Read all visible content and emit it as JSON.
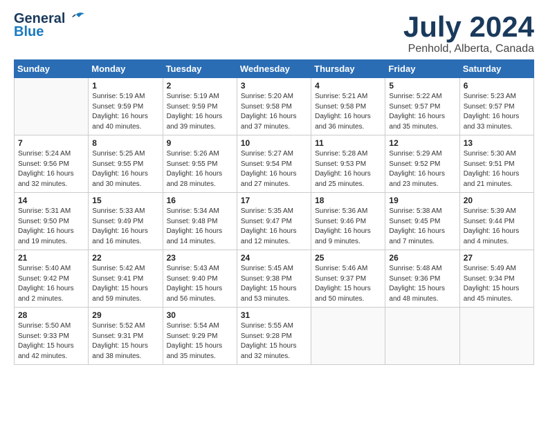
{
  "logo": {
    "line1": "General",
    "line2": "Blue"
  },
  "title": "July 2024",
  "subtitle": "Penhold, Alberta, Canada",
  "days_of_week": [
    "Sunday",
    "Monday",
    "Tuesday",
    "Wednesday",
    "Thursday",
    "Friday",
    "Saturday"
  ],
  "weeks": [
    [
      {
        "day": "",
        "info": ""
      },
      {
        "day": "1",
        "info": "Sunrise: 5:19 AM\nSunset: 9:59 PM\nDaylight: 16 hours\nand 40 minutes."
      },
      {
        "day": "2",
        "info": "Sunrise: 5:19 AM\nSunset: 9:59 PM\nDaylight: 16 hours\nand 39 minutes."
      },
      {
        "day": "3",
        "info": "Sunrise: 5:20 AM\nSunset: 9:58 PM\nDaylight: 16 hours\nand 37 minutes."
      },
      {
        "day": "4",
        "info": "Sunrise: 5:21 AM\nSunset: 9:58 PM\nDaylight: 16 hours\nand 36 minutes."
      },
      {
        "day": "5",
        "info": "Sunrise: 5:22 AM\nSunset: 9:57 PM\nDaylight: 16 hours\nand 35 minutes."
      },
      {
        "day": "6",
        "info": "Sunrise: 5:23 AM\nSunset: 9:57 PM\nDaylight: 16 hours\nand 33 minutes."
      }
    ],
    [
      {
        "day": "7",
        "info": "Sunrise: 5:24 AM\nSunset: 9:56 PM\nDaylight: 16 hours\nand 32 minutes."
      },
      {
        "day": "8",
        "info": "Sunrise: 5:25 AM\nSunset: 9:55 PM\nDaylight: 16 hours\nand 30 minutes."
      },
      {
        "day": "9",
        "info": "Sunrise: 5:26 AM\nSunset: 9:55 PM\nDaylight: 16 hours\nand 28 minutes."
      },
      {
        "day": "10",
        "info": "Sunrise: 5:27 AM\nSunset: 9:54 PM\nDaylight: 16 hours\nand 27 minutes."
      },
      {
        "day": "11",
        "info": "Sunrise: 5:28 AM\nSunset: 9:53 PM\nDaylight: 16 hours\nand 25 minutes."
      },
      {
        "day": "12",
        "info": "Sunrise: 5:29 AM\nSunset: 9:52 PM\nDaylight: 16 hours\nand 23 minutes."
      },
      {
        "day": "13",
        "info": "Sunrise: 5:30 AM\nSunset: 9:51 PM\nDaylight: 16 hours\nand 21 minutes."
      }
    ],
    [
      {
        "day": "14",
        "info": "Sunrise: 5:31 AM\nSunset: 9:50 PM\nDaylight: 16 hours\nand 19 minutes."
      },
      {
        "day": "15",
        "info": "Sunrise: 5:33 AM\nSunset: 9:49 PM\nDaylight: 16 hours\nand 16 minutes."
      },
      {
        "day": "16",
        "info": "Sunrise: 5:34 AM\nSunset: 9:48 PM\nDaylight: 16 hours\nand 14 minutes."
      },
      {
        "day": "17",
        "info": "Sunrise: 5:35 AM\nSunset: 9:47 PM\nDaylight: 16 hours\nand 12 minutes."
      },
      {
        "day": "18",
        "info": "Sunrise: 5:36 AM\nSunset: 9:46 PM\nDaylight: 16 hours\nand 9 minutes."
      },
      {
        "day": "19",
        "info": "Sunrise: 5:38 AM\nSunset: 9:45 PM\nDaylight: 16 hours\nand 7 minutes."
      },
      {
        "day": "20",
        "info": "Sunrise: 5:39 AM\nSunset: 9:44 PM\nDaylight: 16 hours\nand 4 minutes."
      }
    ],
    [
      {
        "day": "21",
        "info": "Sunrise: 5:40 AM\nSunset: 9:42 PM\nDaylight: 16 hours\nand 2 minutes."
      },
      {
        "day": "22",
        "info": "Sunrise: 5:42 AM\nSunset: 9:41 PM\nDaylight: 15 hours\nand 59 minutes."
      },
      {
        "day": "23",
        "info": "Sunrise: 5:43 AM\nSunset: 9:40 PM\nDaylight: 15 hours\nand 56 minutes."
      },
      {
        "day": "24",
        "info": "Sunrise: 5:45 AM\nSunset: 9:38 PM\nDaylight: 15 hours\nand 53 minutes."
      },
      {
        "day": "25",
        "info": "Sunrise: 5:46 AM\nSunset: 9:37 PM\nDaylight: 15 hours\nand 50 minutes."
      },
      {
        "day": "26",
        "info": "Sunrise: 5:48 AM\nSunset: 9:36 PM\nDaylight: 15 hours\nand 48 minutes."
      },
      {
        "day": "27",
        "info": "Sunrise: 5:49 AM\nSunset: 9:34 PM\nDaylight: 15 hours\nand 45 minutes."
      }
    ],
    [
      {
        "day": "28",
        "info": "Sunrise: 5:50 AM\nSunset: 9:33 PM\nDaylight: 15 hours\nand 42 minutes."
      },
      {
        "day": "29",
        "info": "Sunrise: 5:52 AM\nSunset: 9:31 PM\nDaylight: 15 hours\nand 38 minutes."
      },
      {
        "day": "30",
        "info": "Sunrise: 5:54 AM\nSunset: 9:29 PM\nDaylight: 15 hours\nand 35 minutes."
      },
      {
        "day": "31",
        "info": "Sunrise: 5:55 AM\nSunset: 9:28 PM\nDaylight: 15 hours\nand 32 minutes."
      },
      {
        "day": "",
        "info": ""
      },
      {
        "day": "",
        "info": ""
      },
      {
        "day": "",
        "info": ""
      }
    ]
  ]
}
